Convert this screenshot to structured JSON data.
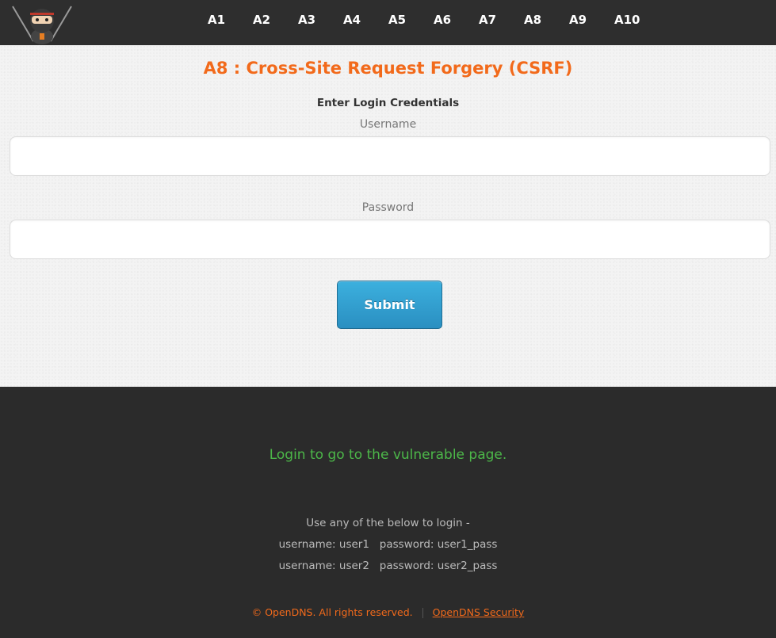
{
  "nav": {
    "logo_icon": "ninja-logo-icon",
    "items": [
      "A1",
      "A2",
      "A3",
      "A4",
      "A5",
      "A6",
      "A7",
      "A8",
      "A9",
      "A10"
    ]
  },
  "main": {
    "title": "A8 : Cross-Site Request Forgery (CSRF)",
    "form_heading": "Enter Login Credentials",
    "username_label": "Username",
    "username_value": "",
    "password_label": "Password",
    "password_value": "",
    "submit_label": "Submit"
  },
  "footer": {
    "notice": "Login to go to the vulnerable page.",
    "instructions": "Use any of the below to login -",
    "credentials": [
      "username: user1   password: user1_pass",
      "username: user2   password: user2_pass"
    ],
    "copyright": "© OpenDNS. All rights reserved.",
    "link": "OpenDNS Security"
  },
  "colors": {
    "accent_orange": "#f26a1b",
    "notice_green": "#4cb749",
    "button_blue": "#2a9fd6",
    "dark_background": "#2b2b2b"
  }
}
